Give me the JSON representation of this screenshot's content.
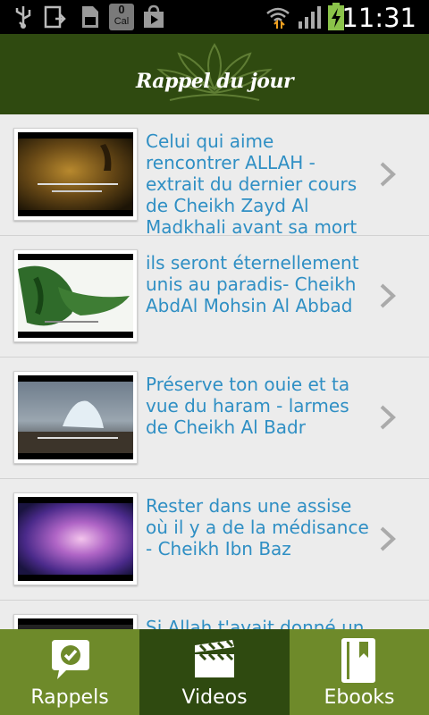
{
  "status_bar": {
    "time": "11:31",
    "notification_badge": "0",
    "notification_badge_sub": "Cal"
  },
  "header": {
    "title": "Rappel du jour"
  },
  "list": {
    "items": [
      {
        "title": "Celui qui aime rencontrer ALLAH - extrait du dernier cours de Cheikh Zayd Al Madkhali avant sa mort"
      },
      {
        "title": "ils seront éternellement unis au paradis- Cheikh AbdAl Mohsin Al Abbad"
      },
      {
        "title": "Préserve ton ouie et ta vue du haram - larmes de Cheikh Al Badr"
      },
      {
        "title": "Rester dans une assise où il y a de la médisance - Cheikh Ibn Baz"
      },
      {
        "title": "Si Allah t'avait donné un"
      }
    ]
  },
  "tabs": [
    {
      "label": "Rappels",
      "icon": "chat-check-icon",
      "selected": false
    },
    {
      "label": "Videos",
      "icon": "clapperboard-icon",
      "selected": true
    },
    {
      "label": "Ebooks",
      "icon": "book-icon",
      "selected": false
    }
  ],
  "colors": {
    "header_bg": "#2f4a10",
    "tabbar_bg": "#6e8a2a",
    "tab_selected_bg": "#2f4a10",
    "link_text": "#2f8fc4"
  }
}
